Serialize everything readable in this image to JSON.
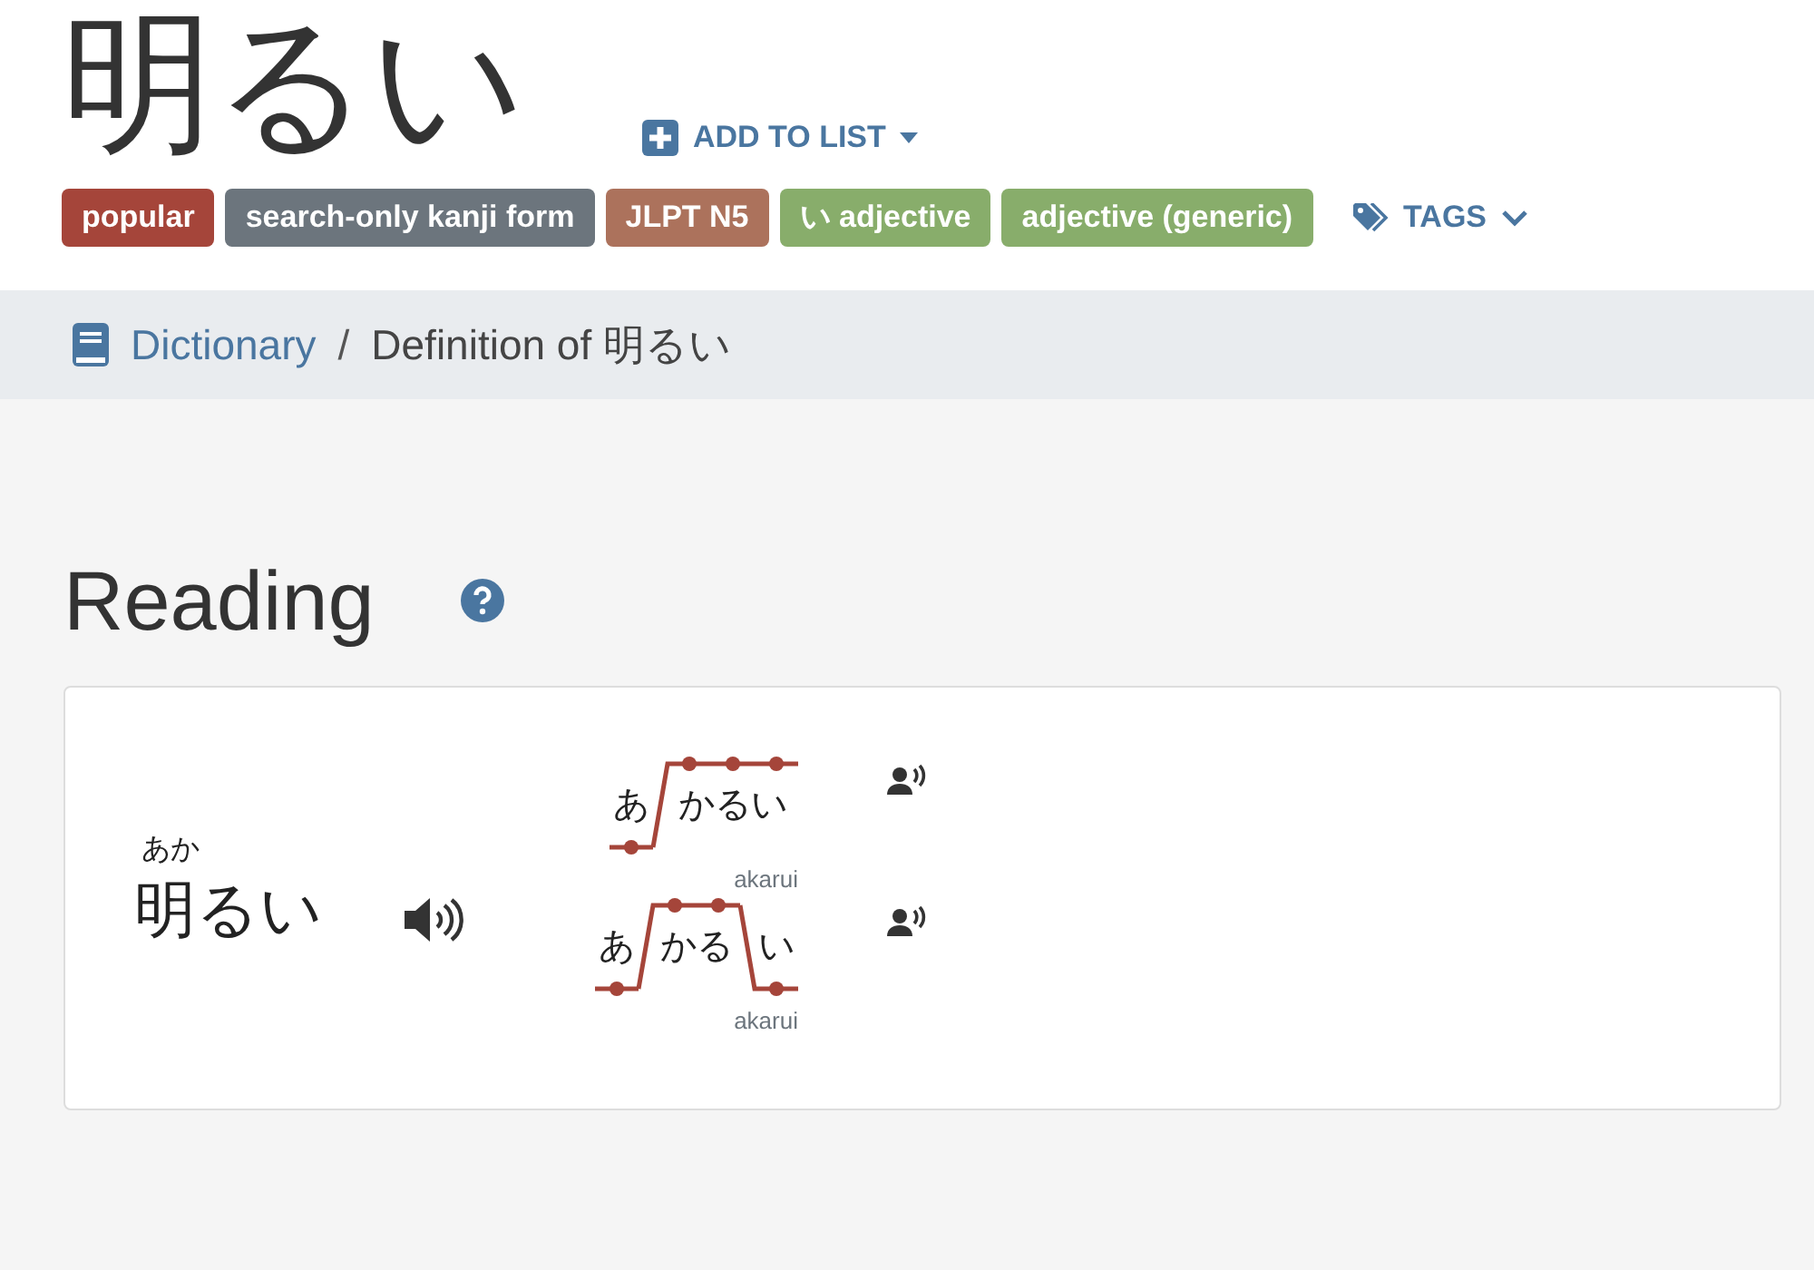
{
  "word": "明るい",
  "add_to_list": "ADD TO LIST",
  "tags": [
    {
      "label": "popular",
      "color": "#a5453a"
    },
    {
      "label": "search-only kanji form",
      "color": "#6c757d"
    },
    {
      "label": "JLPT N5",
      "color": "#ac725c"
    },
    {
      "label": "い adjective",
      "color": "#88ad6b"
    },
    {
      "label": "adjective (generic)",
      "color": "#88ad6b"
    }
  ],
  "tags_toggle": "TAGS",
  "breadcrumb": {
    "link": "Dictionary",
    "separator": "/",
    "current": "Definition of 明るい"
  },
  "section": {
    "title": "Reading"
  },
  "reading": {
    "furigana": "あか",
    "word": "明るい",
    "pitch": [
      {
        "segments": [
          {
            "text": "あ",
            "high": false
          },
          {
            "text": "かるい",
            "high": true
          }
        ],
        "romaji": "akarui"
      },
      {
        "segments": [
          {
            "text": "あ",
            "high": false
          },
          {
            "text": "かる",
            "high": true
          },
          {
            "text": "い",
            "high": false
          }
        ],
        "romaji": "akarui"
      }
    ]
  }
}
